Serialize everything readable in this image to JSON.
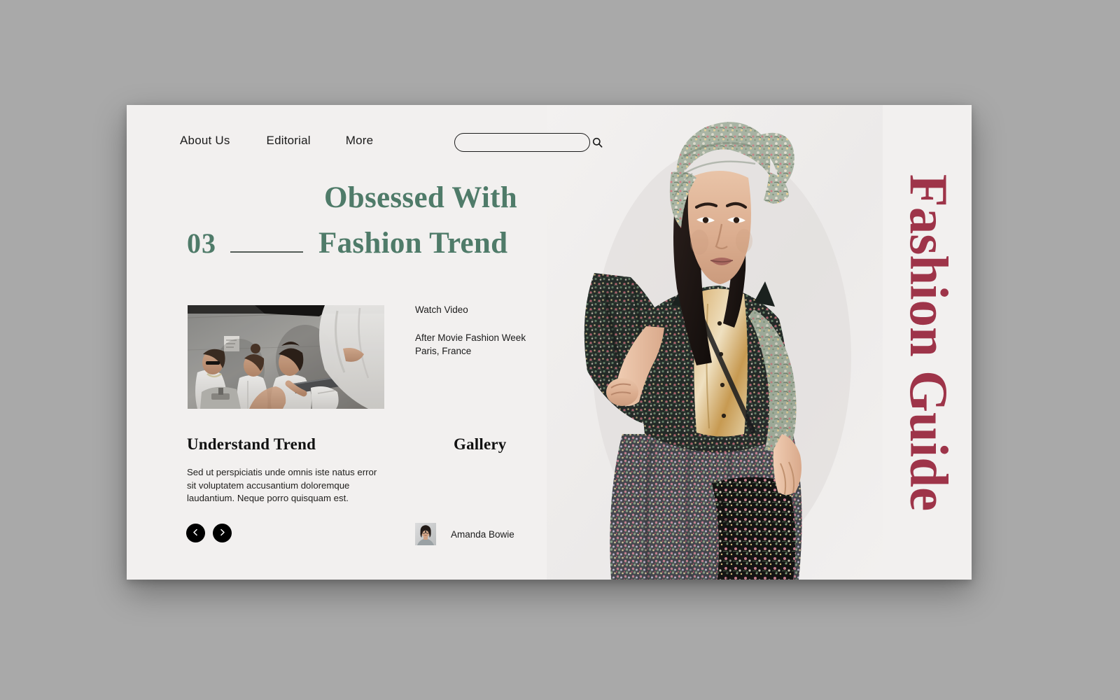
{
  "theme": {
    "page_background": "#a9a9a9",
    "card_background": "#f2f0ef",
    "accent_green": "#4f7b69",
    "accent_crimson": "#9e3449",
    "text_dark": "#1b1b1b"
  },
  "nav": {
    "items": [
      {
        "label": "About Us"
      },
      {
        "label": "Editorial"
      },
      {
        "label": "More"
      }
    ]
  },
  "search": {
    "value": "",
    "placeholder": "",
    "icon": "search-icon"
  },
  "hero": {
    "issue_number": "03",
    "line1": "Obsessed With",
    "line2": "Fashion Trend"
  },
  "video": {
    "link_label": "Watch Video",
    "caption_line1": "After Movie Fashion Week",
    "caption_line2": "Paris, France"
  },
  "trend": {
    "title": "Understand Trend",
    "body": "Sed ut perspiciatis unde omnis iste natus error sit voluptatem accusantium doloremque laudantium. Neque porro quisquam est."
  },
  "gallery": {
    "title": "Gallery"
  },
  "carousel": {
    "prev_icon": "chevron-left-icon",
    "next_icon": "chevron-right-icon"
  },
  "author": {
    "name": "Amanda Bowie",
    "avatar_icon": "avatar-photo"
  },
  "brand": {
    "vertical_text": "Fashion Guide"
  },
  "media": {
    "backstage_photo_name": "backstage-models-photo",
    "model_photo_name": "floral-outfit-model-photo"
  }
}
